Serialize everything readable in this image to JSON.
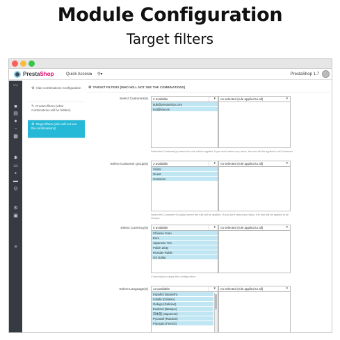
{
  "hero": {
    "title": "Module Configuration",
    "subtitle": "Target filters"
  },
  "topbar": {
    "logo_pre": "Presta",
    "logo_accent": "Shop",
    "quick_access": "Quick Access",
    "quick_access_caret": "▾",
    "search_caret": "▾",
    "version": "PrestaShop 1.7"
  },
  "sidebar_icons": [
    "trend-icon",
    "cart-icon",
    "catalog-icon",
    "customers-icon",
    "chat-icon",
    "stats-icon",
    "modules-icon",
    "design-icon",
    "shipping-icon",
    "payment-icon",
    "international-icon",
    "settings-icon",
    "advanced-icon",
    "menu-icon"
  ],
  "subnav": {
    "items": [
      {
        "icon": "⚙",
        "label": "Hide combinations Configuration"
      },
      {
        "icon": "✎",
        "label": "Product filters (what combinations will be hidden)"
      },
      {
        "icon": "⚙",
        "label": "Target filters (who will not see the combinations)"
      }
    ]
  },
  "panel": {
    "title": "TARGET FILTERS (WHO WILL NOT SEE THE COMBINATIONS)"
  },
  "customers": {
    "label": "Select Customer(s)",
    "left_head": "2 available",
    "right_head": "no selected (rule applied to all)",
    "options": [
      "pub@prestashop.com",
      "test@test.es"
    ],
    "help": "Select the Customer(s) where the rule will be applied. If you don't select any value, the rule will be applied to all Customer."
  },
  "groups": {
    "label": "Select Customer group(s)",
    "left_head": "3 available",
    "right_head": "no selected (rule applied to all)",
    "options": [
      "Visitor",
      "Guest",
      "Customer"
    ],
    "help": "Select the Customer Group(s) where the rule will be applied. If you don't select any value, the rule will be applied to all Groups."
  },
  "currencies": {
    "label": "Select Currency(s)",
    "left_head": "6 available",
    "right_head": "no selected (rule applied to all)",
    "options": [
      "Chinese Yuan",
      "Euro",
      "Japanese Yen",
      "Polish Zloty",
      "Russian Ruble",
      "US Dollar"
    ],
    "help": "Currency(s) to apply this configuration."
  },
  "languages": {
    "label": "Select Language(s)",
    "left_head": "13 available",
    "right_head": "no selected (rule applied to all)",
    "options": [
      "Español (Spanish)",
      "Català (Catalan)",
      "Galego (Galician)",
      "Euskera (Basque)",
      "日本語 (Japanese)",
      "Русский (Russian)",
      "Français (French)"
    ]
  },
  "colors": {
    "sidebar": "#363a41",
    "active": "#25b9d7",
    "selected_option": "#bfe6f2",
    "accent": "#df0067"
  }
}
